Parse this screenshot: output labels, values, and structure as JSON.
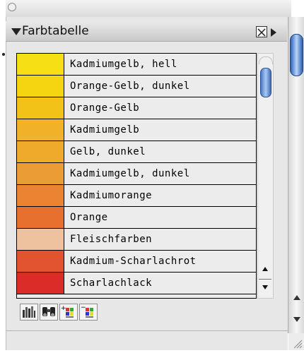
{
  "panel": {
    "title": "Farbtabelle"
  },
  "colors": [
    {
      "name": "Kadmiumgelb, hell",
      "hex": "#f7df16"
    },
    {
      "name": "Orange-Gelb, dunkel",
      "hex": "#f5d50f"
    },
    {
      "name": "Orange-Gelb",
      "hex": "#f3c219"
    },
    {
      "name": "Kadmiumgelb",
      "hex": "#f1b229"
    },
    {
      "name": "Gelb, dunkel",
      "hex": "#efaa2c"
    },
    {
      "name": "Kadmiumgelb, dunkel",
      "hex": "#ec9c35"
    },
    {
      "name": "Kadmiumorange",
      "hex": "#ea8432"
    },
    {
      "name": "Orange",
      "hex": "#e7702f"
    },
    {
      "name": "Fleischfarben",
      "hex": "#efc29f"
    },
    {
      "name": "Kadmium-Scharlachrot",
      "hex": "#e1542f"
    },
    {
      "name": "Scharlachlack",
      "hex": "#dc2c2a"
    }
  ],
  "toolbar": [
    {
      "icon": "color-library-icon"
    },
    {
      "icon": "find-color-icon"
    },
    {
      "icon": "new-swatch-icon"
    },
    {
      "icon": "delete-swatch-icon"
    }
  ]
}
